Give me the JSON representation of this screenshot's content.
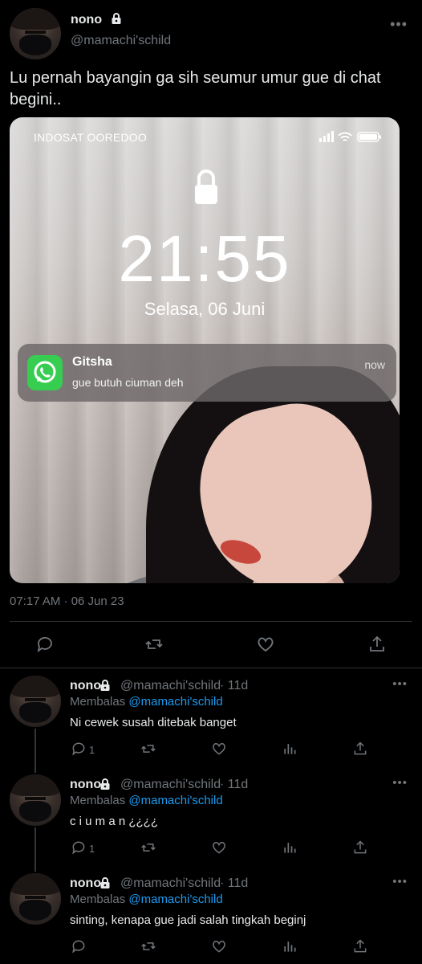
{
  "tweet": {
    "author_name": "nono",
    "author_handle": "@mamachi'schild",
    "more_label": "•••",
    "text": "Lu pernah bayangin ga sih seumur umur gue di chat begini..",
    "timestamp": "07:17 AM · 06 Jun 23"
  },
  "media": {
    "carrier": "INDOSAT OOREDOO",
    "clock": "21:55",
    "date": "Selasa, 06 Juni",
    "notification": {
      "app_icon": "whatsapp-icon",
      "title": "Gitsha",
      "body": "gue butuh ciuman deh",
      "time": "now"
    }
  },
  "actions": {
    "icons": [
      "reply-icon",
      "retweet-icon",
      "like-icon",
      "share-icon"
    ]
  },
  "replies": [
    {
      "name": "nono",
      "handle": "@mamachi'schild",
      "age": "· 11d",
      "replying_prefix": "Membalas",
      "replying_to": "@mamachi'schild",
      "text": "Ni cewek susah ditebak banget",
      "reply_count": "1"
    },
    {
      "name": "nono",
      "handle": "@mamachi'schild",
      "age": "· 11d",
      "replying_prefix": "Membalas",
      "replying_to": "@mamachi'schild",
      "text": "c i u m a n ¿¿¿¿",
      "reply_count": "1"
    },
    {
      "name": "nono",
      "handle": "@mamachi'schild",
      "age": "· 11d",
      "replying_prefix": "Membalas",
      "replying_to": "@mamachi'schild",
      "text": "sinting, kenapa gue jadi salah tingkah beginj",
      "reply_count": ""
    }
  ],
  "colors": {
    "background": "#000000",
    "text": "#e7e9ea",
    "muted": "#71767b",
    "link": "#1d9bf0",
    "whatsapp": "#36cd51"
  }
}
